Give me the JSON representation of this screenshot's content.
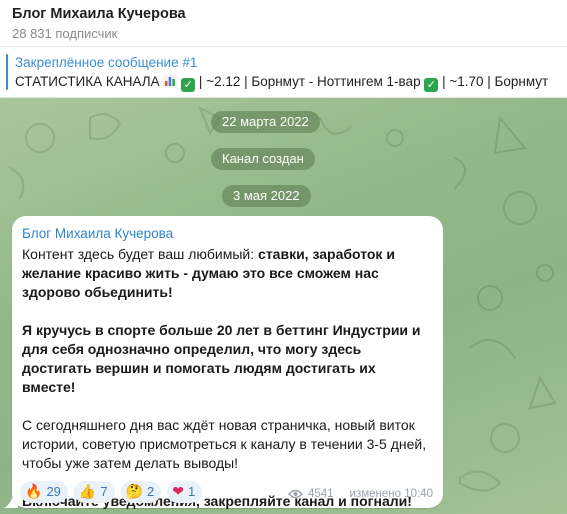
{
  "header": {
    "title": "Блог Михаила Кучерова",
    "subtitle": "28 831 подписчик"
  },
  "pinned": {
    "title": "Закреплённое сообщение #1",
    "text_part1": "СТАТИСТИКА КАНАЛА ",
    "text_part2": " | ~2.12 | Борнмут - Ноттингем 1-вар ",
    "text_part3": " | ~1.70 | Борнмут"
  },
  "service": {
    "date1": "22 марта 2022",
    "created": "Канал создан",
    "date2": "3 мая 2022"
  },
  "message": {
    "author": "Блог Михаила Кучерова",
    "p1_plain": "Контент здесь будет ваш любимый: ",
    "p1_bold": "ставки, заработок и желание красиво жить - думаю это все сможем нас здорово обьединить!",
    "p2_bold": "Я кручусь в спорте больше 20 лет в беттинг Индустрии и для себя однозначно определил, что могу здесь достигать вершин и помогать людям достигать их вместе!",
    "p3": "С сегодняшнего дня вас ждёт новая страничка, новый виток истории, советую присмотреться к каналу в течении 3-5 дней, чтобы уже затем делать выводы!",
    "p4_bold": "Включайте уведомления, закрепляйте канал и погнали!",
    "views": "4541",
    "edited_time": "изменено 10:40"
  },
  "reactions": [
    {
      "emoji": "🔥",
      "count": "29"
    },
    {
      "emoji": "👍",
      "count": "7"
    },
    {
      "emoji": "🤔",
      "count": "2"
    },
    {
      "emoji": "❤",
      "count": "1"
    }
  ],
  "colors": {
    "accent": "#3a8fd1",
    "author": "#2e86c9",
    "check": "#2ea44f"
  }
}
